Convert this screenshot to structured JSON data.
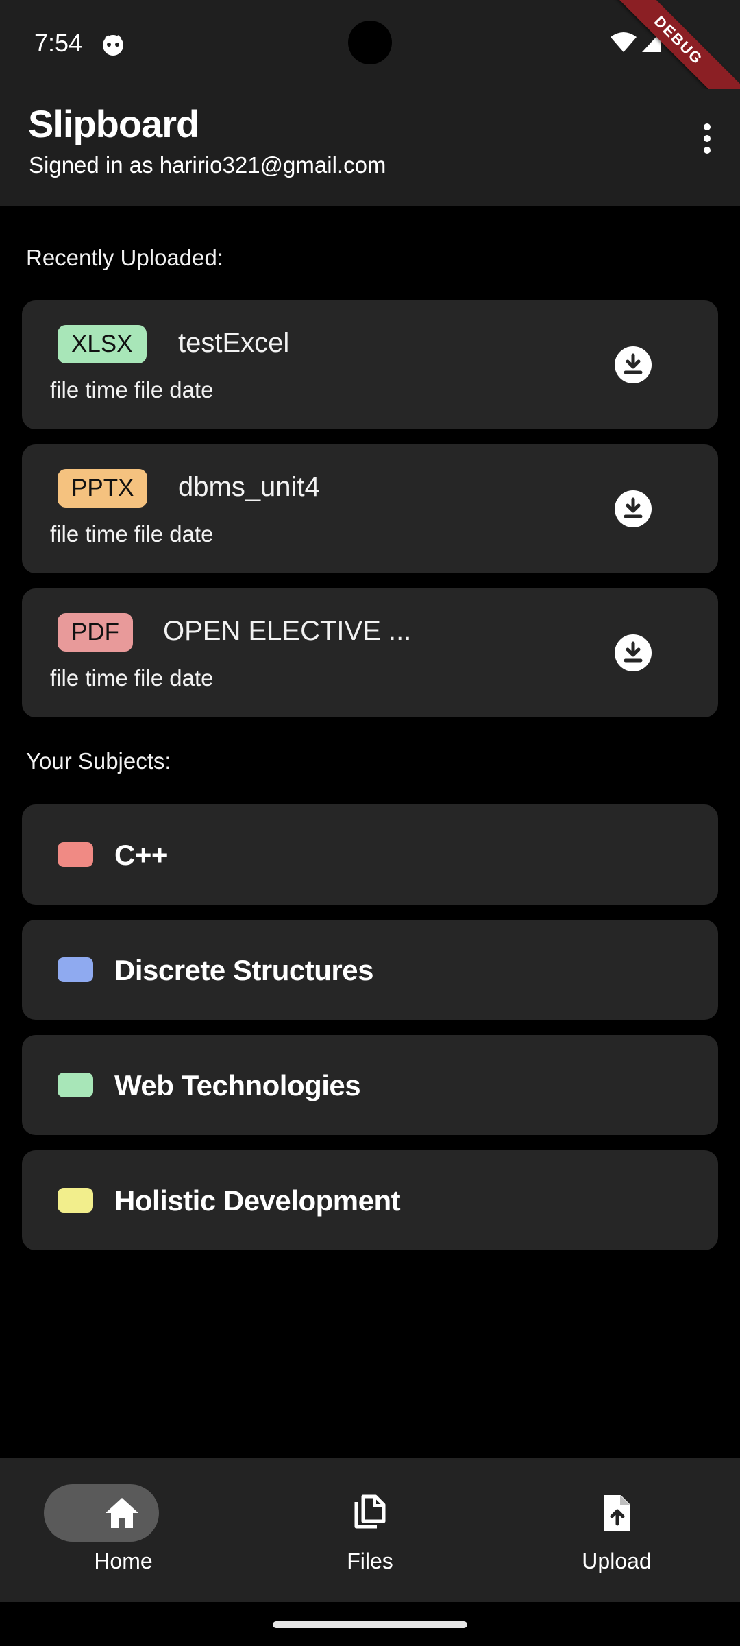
{
  "status_bar": {
    "time": "7:54",
    "debug_banner": "DEBUG"
  },
  "app_bar": {
    "title": "Slipboard",
    "subtitle": "Signed in as haririo321@gmail.com"
  },
  "recent": {
    "label": "Recently Uploaded:",
    "files": [
      {
        "type": "XLSX",
        "type_color": "#a8e6b8",
        "name": "testExcel",
        "meta": "file time file date"
      },
      {
        "type": "PPTX",
        "type_color": "#f5c27f",
        "name": "dbms_unit4",
        "meta": "file time file date"
      },
      {
        "type": "PDF",
        "type_color": "#e89a9a",
        "name": "OPEN ELECTIVE ...",
        "meta": "file time file date"
      }
    ]
  },
  "subjects": {
    "label": "Your Subjects:",
    "items": [
      {
        "name": "C++",
        "color": "#f08a84"
      },
      {
        "name": "Discrete Structures",
        "color": "#8faaf0"
      },
      {
        "name": "Web Technologies",
        "color": "#a8e6b8"
      },
      {
        "name": "Holistic Development",
        "color": "#f2ee8c"
      }
    ]
  },
  "bottom_nav": {
    "items": [
      {
        "label": "Home",
        "icon": "home-icon",
        "selected": true
      },
      {
        "label": "Files",
        "icon": "files-icon",
        "selected": false
      },
      {
        "label": "Upload",
        "icon": "upload-icon",
        "selected": false
      }
    ]
  }
}
